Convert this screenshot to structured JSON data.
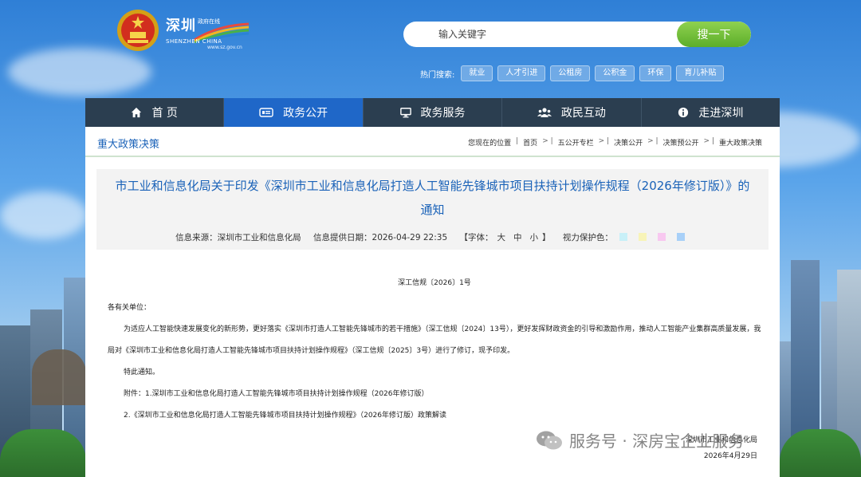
{
  "header": {
    "logo_main": "深圳",
    "logo_sub": "政府在线",
    "logo_en": "SHENZHEN CHINA",
    "logo_url": "www.sz.gov.cn"
  },
  "search": {
    "placeholder": "输入关键字",
    "button_label": "搜一下"
  },
  "hot_search": {
    "label": "热门搜索:",
    "tags": [
      "就业",
      "人才引进",
      "公租房",
      "公积金",
      "环保",
      "育儿补贴"
    ]
  },
  "nav": {
    "items": [
      {
        "label": "首 页",
        "icon": "home-icon"
      },
      {
        "label": "政务公开",
        "icon": "news-icon"
      },
      {
        "label": "政务服务",
        "icon": "monitor-icon"
      },
      {
        "label": "政民互动",
        "icon": "people-icon"
      },
      {
        "label": "走进深圳",
        "icon": "info-icon"
      }
    ],
    "active_color": "#1f67c8",
    "bar_color": "#2b3e50"
  },
  "breadcrumb": {
    "section_title": "重大政策决策",
    "prefix": "您现在的位置",
    "items": [
      "首页",
      "五公开专栏",
      "决策公开",
      "决策预公开",
      "重大政策决策"
    ]
  },
  "article": {
    "title": "市工业和信息化局关于印发《深圳市工业和信息化局打造人工智能先锋城市项目扶持计划操作规程（2026年修订版）》的通知",
    "source_label": "信息来源：",
    "source": "深圳市工业和信息化局",
    "date_label": "信息提供日期：",
    "date": "2026-04-29 22:35",
    "font_label": "【字体：",
    "font_large": "大",
    "font_medium": "中",
    "font_small": "小",
    "font_close": "】",
    "eye_label": "视力保护色：",
    "eye_colors": [
      "#c8f0f8",
      "#f8f4b8",
      "#f8c8f0",
      "#a8d0f8"
    ]
  },
  "body": {
    "doc_no": "深工信规〔2026〕1号",
    "greeting": "各有关单位：",
    "para1": "为适应人工智能快速发展变化的新形势，更好落实《深圳市打造人工智能先锋城市的若干措施》（深工信规〔2024〕13号），更好发挥财政资金的引导和激励作用，推动人工智能产业集群高质量发展，我局对《深圳市工业和信息化局打造人工智能先锋城市项目扶持计划操作规程》（深工信规〔2025〕3号）进行了修订，现予印发。",
    "para2": "特此通知。",
    "attach1": "附件：1.深圳市工业和信息化局打造人工智能先锋城市项目扶持计划操作规程（2026年修订版）",
    "attach2": "2.《深圳市工业和信息化局打造人工智能先锋城市项目扶持计划操作规程》（2026年修订版）政策解读",
    "sign_org": "深圳市工业和信息化局",
    "sign_date": "2026年4月29日"
  },
  "watermark": {
    "text": "服务号 · 深房宝企业服务"
  }
}
